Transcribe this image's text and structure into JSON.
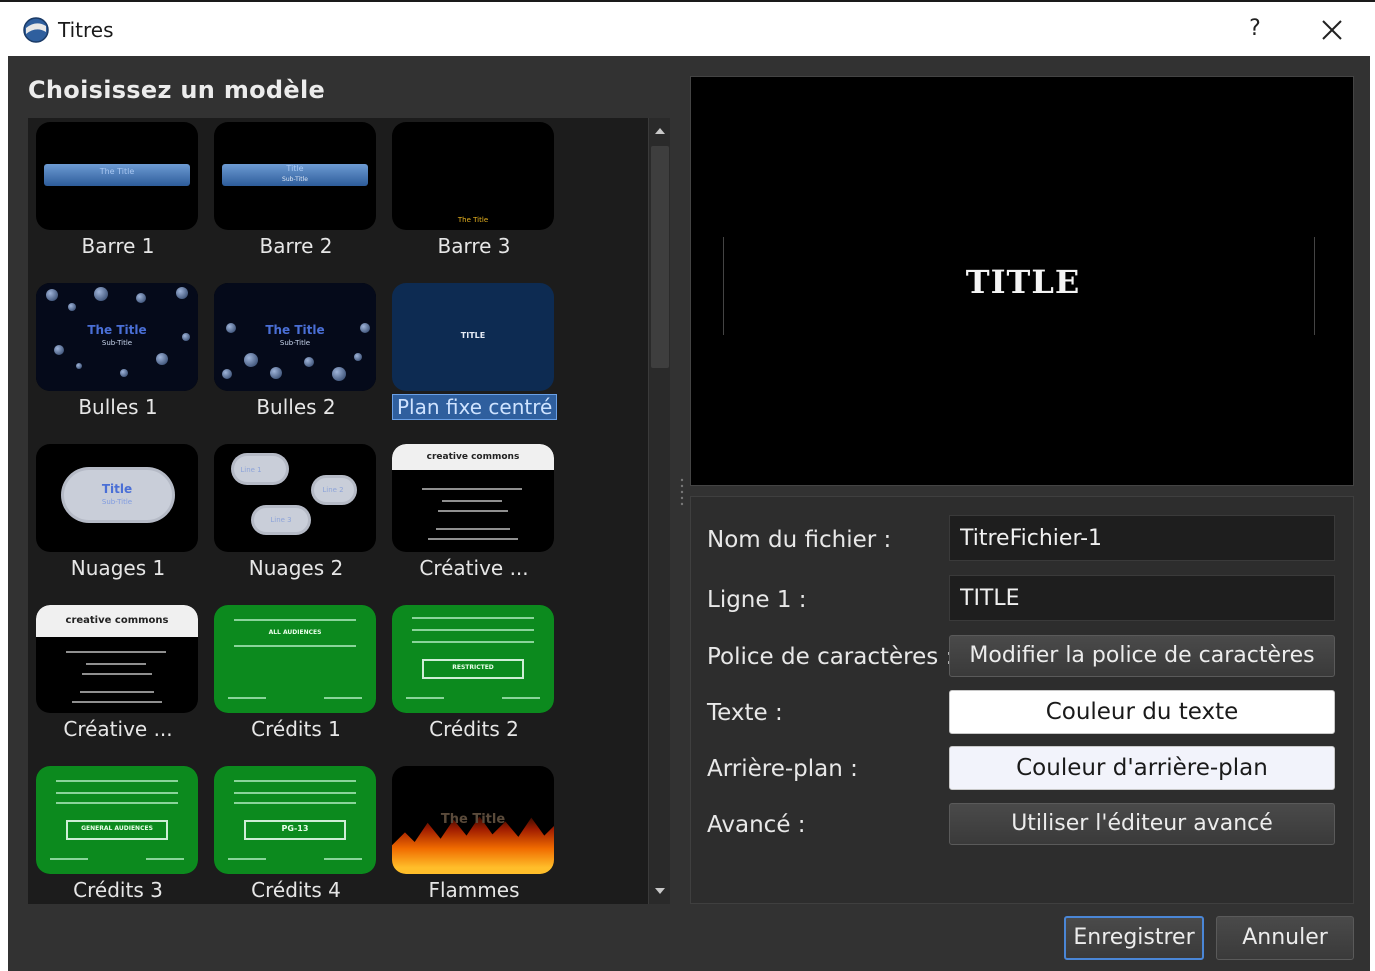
{
  "window": {
    "title": "Titres",
    "help_glyph": "?",
    "icon": "globe-icon"
  },
  "templates": {
    "heading": "Choisissez un modèle",
    "selected": "Plan fixe centré",
    "items": [
      {
        "label": "Barre 1",
        "thumb_text": "The Title"
      },
      {
        "label": "Barre 2",
        "thumb_text": "Title",
        "thumb_sub": "Sub-Title"
      },
      {
        "label": "Barre 3",
        "thumb_text": "The Title"
      },
      {
        "label": "Bulles 1",
        "thumb_text": "The Title",
        "thumb_sub": "Sub-Title"
      },
      {
        "label": "Bulles 2",
        "thumb_text": "The Title",
        "thumb_sub": "Sub-Title"
      },
      {
        "label": "Plan fixe centré",
        "thumb_text": "TITLE"
      },
      {
        "label": "Nuages 1",
        "thumb_text": "Title",
        "thumb_sub": "Sub-Title"
      },
      {
        "label": "Nuages 2",
        "thumb_text": "Line 1",
        "thumb_sub": "Line 2",
        "thumb_third": "Line 3"
      },
      {
        "label": "Créative ...",
        "thumb_text": "creative commons"
      },
      {
        "label": "Créative ...",
        "thumb_text": "creative commons"
      },
      {
        "label": "Crédits 1",
        "thumb_text": "ALL AUDIENCES"
      },
      {
        "label": "Crédits 2",
        "thumb_text": "RESTRICTED"
      },
      {
        "label": "Crédits 3",
        "thumb_text": "GENERAL AUDIENCES"
      },
      {
        "label": "Crédits 4",
        "thumb_text": "PG-13"
      },
      {
        "label": "Flammes",
        "thumb_text": "The Title"
      }
    ]
  },
  "preview": {
    "title_text": "TITLE"
  },
  "form": {
    "filename_label": "Nom du fichier :",
    "filename_value": "TitreFichier-1",
    "line1_label": "Ligne 1 :",
    "line1_value": "TITLE",
    "font_label": "Police de caractères :",
    "font_button": "Modifier la police de caractères",
    "text_label": "Texte :",
    "text_color_button": "Couleur du texte",
    "background_label": "Arrière-plan :",
    "background_color_button": "Couleur d'arrière-plan",
    "advanced_label": "Avancé :",
    "advanced_button": "Utiliser l'éditeur avancé"
  },
  "footer": {
    "save": "Enregistrer",
    "cancel": "Annuler"
  },
  "colors": {
    "dialog_bg": "#323232",
    "selection": "#2f5f9e",
    "accent_border": "#4a86d6",
    "credits_green": "#0c8a1e"
  }
}
